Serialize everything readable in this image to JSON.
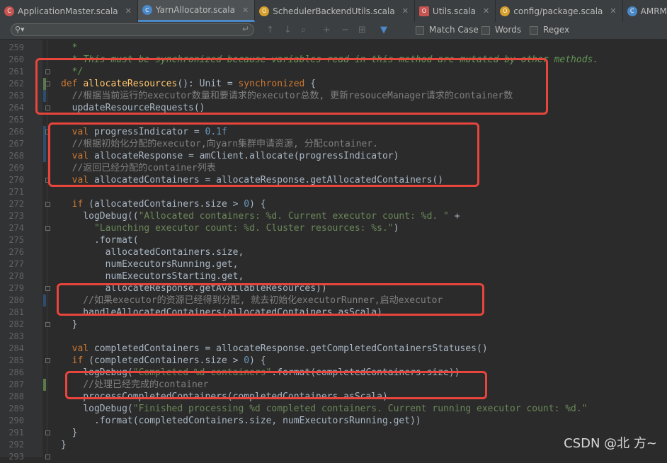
{
  "tabs": [
    {
      "label": "ApplicationMaster.scala",
      "icon": "scala-class-icon",
      "color": "#c75450",
      "active": false
    },
    {
      "label": "YarnAllocator.scala",
      "icon": "scala-class-icon",
      "color": "#4a88c7",
      "active": true
    },
    {
      "label": "SchedulerBackendUtils.scala",
      "icon": "scala-object-icon",
      "color": "#d6a02d",
      "active": false
    },
    {
      "label": "Utils.scala",
      "icon": "scala-object-icon",
      "color": "#c75450",
      "active": false
    },
    {
      "label": "config/package.scala",
      "icon": "package-object-icon",
      "color": "#d6a02d",
      "active": false
    },
    {
      "label": "AMRMClientImpl.java",
      "icon": "java-class-icon",
      "color": "#4a88c7",
      "active": false
    }
  ],
  "search": {
    "value": "",
    "match_case": "Match Case",
    "words": "Words",
    "regex": "Regex"
  },
  "code_lines": [
    {
      "num": "259",
      "text": "  *"
    },
    {
      "num": "260",
      "text": "  * This must be synchronized because variables read in this method are mutated by other methods."
    },
    {
      "num": "261",
      "text": "  */"
    },
    {
      "num": "262",
      "text": "def allocateResources(): Unit = synchronized {"
    },
    {
      "num": "263",
      "text": "  //根据当前运行的executor数量和要请求的executor总数, 更新resouceManager请求的container数"
    },
    {
      "num": "264",
      "text": "  updateResourceRequests()"
    },
    {
      "num": "265",
      "text": ""
    },
    {
      "num": "266",
      "text": "  val progressIndicator = 0.1f"
    },
    {
      "num": "267",
      "text": "  //根据初始化分配的executor,向yarn集群申请资源, 分配container."
    },
    {
      "num": "268",
      "text": "  val allocateResponse = amClient.allocate(progressIndicator)"
    },
    {
      "num": "269",
      "text": "  //返回已经分配的container列表"
    },
    {
      "num": "270",
      "text": "  val allocatedContainers = allocateResponse.getAllocatedContainers()"
    },
    {
      "num": "271",
      "text": ""
    },
    {
      "num": "272",
      "text": "  if (allocatedContainers.size > 0) {"
    },
    {
      "num": "273",
      "text": "    logDebug((\"Allocated containers: %d. Current executor count: %d. \" +"
    },
    {
      "num": "274",
      "text": "      \"Launching executor count: %d. Cluster resources: %s.\")"
    },
    {
      "num": "275",
      "text": "      .format("
    },
    {
      "num": "276",
      "text": "        allocatedContainers.size,"
    },
    {
      "num": "277",
      "text": "        numExecutorsRunning.get,"
    },
    {
      "num": "278",
      "text": "        numExecutorsStarting.get,"
    },
    {
      "num": "279",
      "text": "        allocateResponse.getAvailableResources))"
    },
    {
      "num": "280",
      "text": "    //如果executor的资源已经得到分配, 就去初始化executorRunner,启动executor"
    },
    {
      "num": "281",
      "text": "    handleAllocatedContainers(allocatedContainers.asScala)"
    },
    {
      "num": "282",
      "text": "  }"
    },
    {
      "num": "283",
      "text": ""
    },
    {
      "num": "284",
      "text": "  val completedContainers = allocateResponse.getCompletedContainersStatuses()"
    },
    {
      "num": "285",
      "text": "  if (completedContainers.size > 0) {"
    },
    {
      "num": "286",
      "text": "    logDebug(\"Completed %d containers\".format(completedContainers.size))"
    },
    {
      "num": "287",
      "text": "    //处理已经完成的container"
    },
    {
      "num": "288",
      "text": "    processCompletedContainers(completedContainers.asScala)"
    },
    {
      "num": "289",
      "text": "    logDebug(\"Finished processing %d completed containers. Current running executor count: %d.\""
    },
    {
      "num": "290",
      "text": "      .format(completedContainers.size, numExecutorsRunning.get))"
    },
    {
      "num": "291",
      "text": "  }"
    },
    {
      "num": "292",
      "text": "}"
    },
    {
      "num": "293",
      "text": ""
    }
  ],
  "watermark": "CSDN @北 方~",
  "colors": {
    "highlight_box": "#e8453c",
    "keyword": "#cc7832",
    "string": "#6a8759",
    "comment": "#808080"
  }
}
